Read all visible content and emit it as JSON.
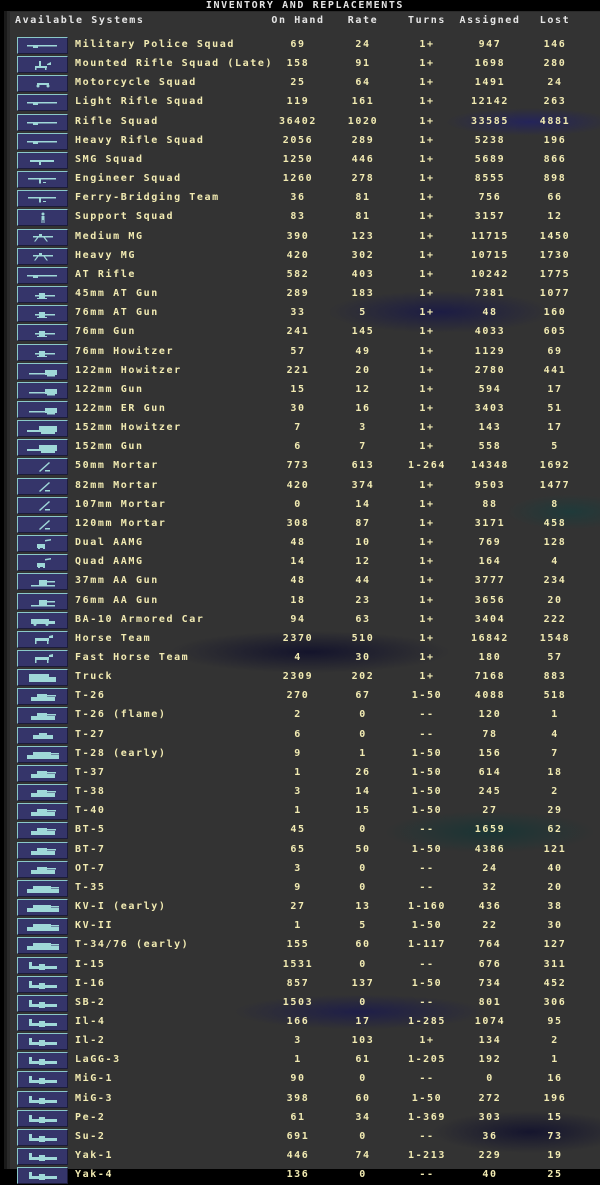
{
  "window_title": "INVENTORY AND REPLACEMENTS",
  "columns": {
    "system": "Available Systems",
    "on_hand": "On Hand",
    "rate": "Rate",
    "turns": "Turns",
    "assigned": "Assigned",
    "lost": "Lost"
  },
  "colors": {
    "text": "#f2ebb2",
    "header": "#e6e6e6",
    "button": "#35356a",
    "icon": "#9fd8d8"
  },
  "rows": [
    {
      "name": "Military Police Squad",
      "icon": "rifle-icon",
      "on_hand": "69",
      "rate": "24",
      "turns": "1+",
      "assigned": "947",
      "lost": "146"
    },
    {
      "name": "Mounted Rifle Squad (Late)",
      "icon": "horse-rider-icon",
      "on_hand": "158",
      "rate": "91",
      "turns": "1+",
      "assigned": "1698",
      "lost": "280"
    },
    {
      "name": "Motorcycle Squad",
      "icon": "motorcycle-icon",
      "on_hand": "25",
      "rate": "64",
      "turns": "1+",
      "assigned": "1491",
      "lost": "24"
    },
    {
      "name": "Light Rifle Squad",
      "icon": "rifle-icon",
      "on_hand": "119",
      "rate": "161",
      "turns": "1+",
      "assigned": "12142",
      "lost": "263"
    },
    {
      "name": "Rifle Squad",
      "icon": "rifle-icon",
      "on_hand": "36402",
      "rate": "1020",
      "turns": "1+",
      "assigned": "33585",
      "lost": "4881"
    },
    {
      "name": "Heavy Rifle Squad",
      "icon": "rifle-icon",
      "on_hand": "2056",
      "rate": "289",
      "turns": "1+",
      "assigned": "5238",
      "lost": "196"
    },
    {
      "name": "SMG Squad",
      "icon": "smg-icon",
      "on_hand": "1250",
      "rate": "446",
      "turns": "1+",
      "assigned": "5689",
      "lost": "866"
    },
    {
      "name": "Engineer Squad",
      "icon": "engineer-icon",
      "on_hand": "1260",
      "rate": "278",
      "turns": "1+",
      "assigned": "8555",
      "lost": "898"
    },
    {
      "name": "Ferry-Bridging Team",
      "icon": "engineer-icon",
      "on_hand": "36",
      "rate": "81",
      "turns": "1+",
      "assigned": "756",
      "lost": "66"
    },
    {
      "name": "Support Squad",
      "icon": "soldier-icon",
      "on_hand": "83",
      "rate": "81",
      "turns": "1+",
      "assigned": "3157",
      "lost": "12"
    },
    {
      "name": "Medium MG",
      "icon": "machine-gun-icon",
      "on_hand": "390",
      "rate": "123",
      "turns": "1+",
      "assigned": "11715",
      "lost": "1450"
    },
    {
      "name": "Heavy MG",
      "icon": "machine-gun-icon",
      "on_hand": "420",
      "rate": "302",
      "turns": "1+",
      "assigned": "10715",
      "lost": "1730"
    },
    {
      "name": "AT Rifle",
      "icon": "rifle-icon",
      "on_hand": "582",
      "rate": "403",
      "turns": "1+",
      "assigned": "10242",
      "lost": "1775"
    },
    {
      "name": "45mm AT Gun",
      "icon": "field-gun-icon",
      "on_hand": "289",
      "rate": "183",
      "turns": "1+",
      "assigned": "7381",
      "lost": "1077"
    },
    {
      "name": "76mm AT Gun",
      "icon": "field-gun-icon",
      "on_hand": "33",
      "rate": "5",
      "turns": "1+",
      "assigned": "48",
      "lost": "160"
    },
    {
      "name": "76mm Gun",
      "icon": "field-gun-icon",
      "on_hand": "241",
      "rate": "145",
      "turns": "1+",
      "assigned": "4033",
      "lost": "605"
    },
    {
      "name": "76mm Howitzer",
      "icon": "field-gun-icon",
      "on_hand": "57",
      "rate": "49",
      "turns": "1+",
      "assigned": "1129",
      "lost": "69"
    },
    {
      "name": "122mm Howitzer",
      "icon": "howitzer-icon",
      "on_hand": "221",
      "rate": "20",
      "turns": "1+",
      "assigned": "2780",
      "lost": "441"
    },
    {
      "name": "122mm Gun",
      "icon": "howitzer-icon",
      "on_hand": "15",
      "rate": "12",
      "turns": "1+",
      "assigned": "594",
      "lost": "17"
    },
    {
      "name": "122mm ER Gun",
      "icon": "howitzer-icon",
      "on_hand": "30",
      "rate": "16",
      "turns": "1+",
      "assigned": "3403",
      "lost": "51"
    },
    {
      "name": "152mm Howitzer",
      "icon": "heavy-gun-icon",
      "on_hand": "7",
      "rate": "3",
      "turns": "1+",
      "assigned": "143",
      "lost": "17"
    },
    {
      "name": "152mm Gun",
      "icon": "heavy-gun-icon",
      "on_hand": "6",
      "rate": "7",
      "turns": "1+",
      "assigned": "558",
      "lost": "5"
    },
    {
      "name": "50mm Mortar",
      "icon": "mortar-icon",
      "on_hand": "773",
      "rate": "613",
      "turns": "1-264",
      "assigned": "14348",
      "lost": "1692"
    },
    {
      "name": "82mm Mortar",
      "icon": "mortar-icon",
      "on_hand": "420",
      "rate": "374",
      "turns": "1+",
      "assigned": "9503",
      "lost": "1477"
    },
    {
      "name": "107mm Mortar",
      "icon": "mortar-icon",
      "on_hand": "0",
      "rate": "14",
      "turns": "1+",
      "assigned": "88",
      "lost": "8"
    },
    {
      "name": "120mm Mortar",
      "icon": "mortar-icon",
      "on_hand": "308",
      "rate": "87",
      "turns": "1+",
      "assigned": "3171",
      "lost": "458"
    },
    {
      "name": "Dual AAMG",
      "icon": "aa-mg-icon",
      "on_hand": "48",
      "rate": "10",
      "turns": "1+",
      "assigned": "769",
      "lost": "128"
    },
    {
      "name": "Quad AAMG",
      "icon": "aa-mg-icon",
      "on_hand": "14",
      "rate": "12",
      "turns": "1+",
      "assigned": "164",
      "lost": "4"
    },
    {
      "name": "37mm AA Gun",
      "icon": "aa-gun-icon",
      "on_hand": "48",
      "rate": "44",
      "turns": "1+",
      "assigned": "3777",
      "lost": "234"
    },
    {
      "name": "76mm AA Gun",
      "icon": "aa-gun-icon",
      "on_hand": "18",
      "rate": "23",
      "turns": "1+",
      "assigned": "3656",
      "lost": "20"
    },
    {
      "name": "BA-10 Armored Car",
      "icon": "armored-car-icon",
      "on_hand": "94",
      "rate": "63",
      "turns": "1+",
      "assigned": "3404",
      "lost": "222"
    },
    {
      "name": "Horse Team",
      "icon": "horse-icon",
      "on_hand": "2370",
      "rate": "510",
      "turns": "1+",
      "assigned": "16842",
      "lost": "1548"
    },
    {
      "name": "Fast Horse Team",
      "icon": "horse-icon",
      "on_hand": "4",
      "rate": "30",
      "turns": "1+",
      "assigned": "180",
      "lost": "57"
    },
    {
      "name": "Truck",
      "icon": "truck-icon",
      "on_hand": "2309",
      "rate": "202",
      "turns": "1+",
      "assigned": "7168",
      "lost": "883"
    },
    {
      "name": "T-26",
      "icon": "tank-icon",
      "on_hand": "270",
      "rate": "67",
      "turns": "1-50",
      "assigned": "4088",
      "lost": "518"
    },
    {
      "name": "T-26 (flame)",
      "icon": "tank-icon",
      "on_hand": "2",
      "rate": "0",
      "turns": "--",
      "assigned": "120",
      "lost": "1"
    },
    {
      "name": "T-27",
      "icon": "tankette-icon",
      "on_hand": "6",
      "rate": "0",
      "turns": "--",
      "assigned": "78",
      "lost": "4"
    },
    {
      "name": "T-28 (early)",
      "icon": "heavy-tank-icon",
      "on_hand": "9",
      "rate": "1",
      "turns": "1-50",
      "assigned": "156",
      "lost": "7"
    },
    {
      "name": "T-37",
      "icon": "tank-icon",
      "on_hand": "1",
      "rate": "26",
      "turns": "1-50",
      "assigned": "614",
      "lost": "18"
    },
    {
      "name": "T-38",
      "icon": "tank-icon",
      "on_hand": "3",
      "rate": "14",
      "turns": "1-50",
      "assigned": "245",
      "lost": "2"
    },
    {
      "name": "T-40",
      "icon": "tank-icon",
      "on_hand": "1",
      "rate": "15",
      "turns": "1-50",
      "assigned": "27",
      "lost": "29"
    },
    {
      "name": "BT-5",
      "icon": "tank-icon",
      "on_hand": "45",
      "rate": "0",
      "turns": "--",
      "assigned": "1659",
      "lost": "62"
    },
    {
      "name": "BT-7",
      "icon": "tank-icon",
      "on_hand": "65",
      "rate": "50",
      "turns": "1-50",
      "assigned": "4386",
      "lost": "121"
    },
    {
      "name": "OT-7",
      "icon": "tank-icon",
      "on_hand": "3",
      "rate": "0",
      "turns": "--",
      "assigned": "24",
      "lost": "40"
    },
    {
      "name": "T-35",
      "icon": "heavy-tank-icon",
      "on_hand": "9",
      "rate": "0",
      "turns": "--",
      "assigned": "32",
      "lost": "20"
    },
    {
      "name": "KV-I (early)",
      "icon": "heavy-tank-icon",
      "on_hand": "27",
      "rate": "13",
      "turns": "1-160",
      "assigned": "436",
      "lost": "38"
    },
    {
      "name": "KV-II",
      "icon": "heavy-tank-icon",
      "on_hand": "1",
      "rate": "5",
      "turns": "1-50",
      "assigned": "22",
      "lost": "30"
    },
    {
      "name": "T-34/76 (early)",
      "icon": "heavy-tank-icon",
      "on_hand": "155",
      "rate": "60",
      "turns": "1-117",
      "assigned": "764",
      "lost": "127"
    },
    {
      "name": "I-15",
      "icon": "aircraft-icon",
      "on_hand": "1531",
      "rate": "0",
      "turns": "--",
      "assigned": "676",
      "lost": "311"
    },
    {
      "name": "I-16",
      "icon": "aircraft-icon",
      "on_hand": "857",
      "rate": "137",
      "turns": "1-50",
      "assigned": "734",
      "lost": "452"
    },
    {
      "name": "SB-2",
      "icon": "aircraft-icon",
      "on_hand": "1503",
      "rate": "0",
      "turns": "--",
      "assigned": "801",
      "lost": "306"
    },
    {
      "name": "Il-4",
      "icon": "aircraft-icon",
      "on_hand": "166",
      "rate": "17",
      "turns": "1-285",
      "assigned": "1074",
      "lost": "95"
    },
    {
      "name": "Il-2",
      "icon": "aircraft-icon",
      "on_hand": "3",
      "rate": "103",
      "turns": "1+",
      "assigned": "134",
      "lost": "2"
    },
    {
      "name": "LaGG-3",
      "icon": "aircraft-icon",
      "on_hand": "1",
      "rate": "61",
      "turns": "1-205",
      "assigned": "192",
      "lost": "1"
    },
    {
      "name": "MiG-1",
      "icon": "aircraft-icon",
      "on_hand": "90",
      "rate": "0",
      "turns": "--",
      "assigned": "0",
      "lost": "16"
    },
    {
      "name": "MiG-3",
      "icon": "aircraft-icon",
      "on_hand": "398",
      "rate": "60",
      "turns": "1-50",
      "assigned": "272",
      "lost": "196"
    },
    {
      "name": "Pe-2",
      "icon": "aircraft-icon",
      "on_hand": "61",
      "rate": "34",
      "turns": "1-369",
      "assigned": "303",
      "lost": "15"
    },
    {
      "name": "Su-2",
      "icon": "aircraft-icon",
      "on_hand": "691",
      "rate": "0",
      "turns": "--",
      "assigned": "36",
      "lost": "73"
    },
    {
      "name": "Yak-1",
      "icon": "aircraft-icon",
      "on_hand": "446",
      "rate": "74",
      "turns": "1-213",
      "assigned": "229",
      "lost": "19"
    },
    {
      "name": "Yak-4",
      "icon": "aircraft-icon",
      "on_hand": "136",
      "rate": "0",
      "turns": "--",
      "assigned": "40",
      "lost": "25"
    }
  ]
}
